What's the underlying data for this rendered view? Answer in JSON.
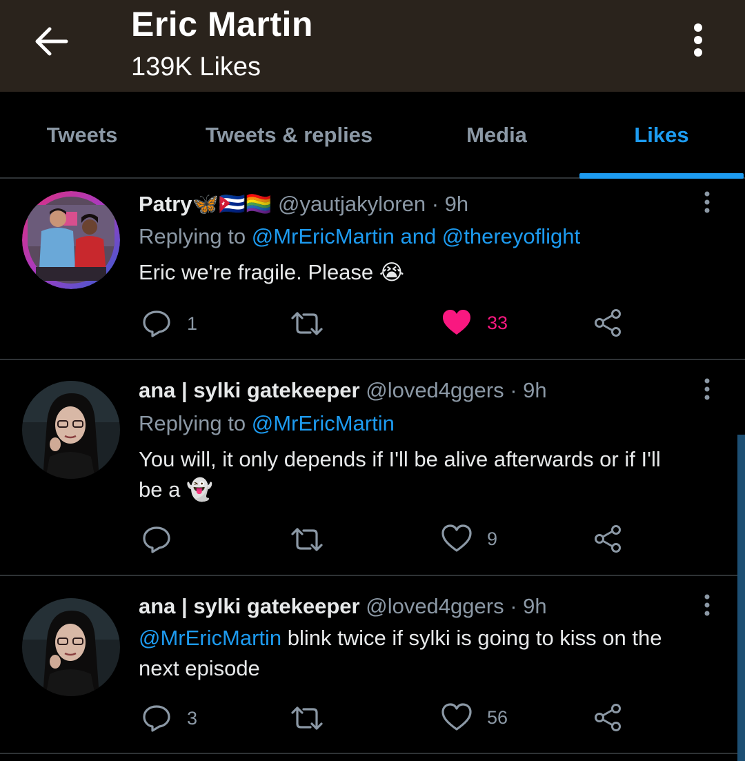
{
  "header": {
    "title": "Eric Martin",
    "subtitle": "139K Likes"
  },
  "tabs": [
    {
      "label": "Tweets",
      "active": false
    },
    {
      "label": "Tweets & replies",
      "active": false
    },
    {
      "label": "Media",
      "active": false
    },
    {
      "label": "Likes",
      "active": true
    }
  ],
  "colors": {
    "accent": "#1d9bf0",
    "like_active": "#f91880",
    "header_bg": "#2a231c",
    "muted_text": "#8b98a5"
  },
  "tweets": [
    {
      "name": "Patry🦋🇨🇺🏳️‍🌈",
      "handle": "@yautjakyloren",
      "time": "· 9h",
      "reply_prefix": "Replying to ",
      "reply_to": "@MrEricMartin and @thereyoflight",
      "mention": "",
      "text": "Eric we're fragile. Please 😭",
      "text_line2": "",
      "replies": "1",
      "retweets": "",
      "likes": "33",
      "liked": true
    },
    {
      "name": "ana | sylki gatekeeper",
      "handle": "@loved4ggers",
      "time": "· 9h",
      "reply_prefix": "Replying to ",
      "reply_to": "@MrEricMartin",
      "mention": "",
      "text": "You will, it only depends if I'll be alive afterwards or if I'll",
      "text_line2": "be a 👻",
      "replies": "",
      "retweets": "",
      "likes": "9",
      "liked": false
    },
    {
      "name": "ana | sylki gatekeeper",
      "handle": "@loved4ggers",
      "time": "· 9h",
      "reply_prefix": "",
      "reply_to": "",
      "mention": "@MrEricMartin",
      "text": " blink twice if sylki is going to kiss on the",
      "text_line2": "next episode",
      "replies": "3",
      "retweets": "",
      "likes": "56",
      "liked": false
    }
  ]
}
